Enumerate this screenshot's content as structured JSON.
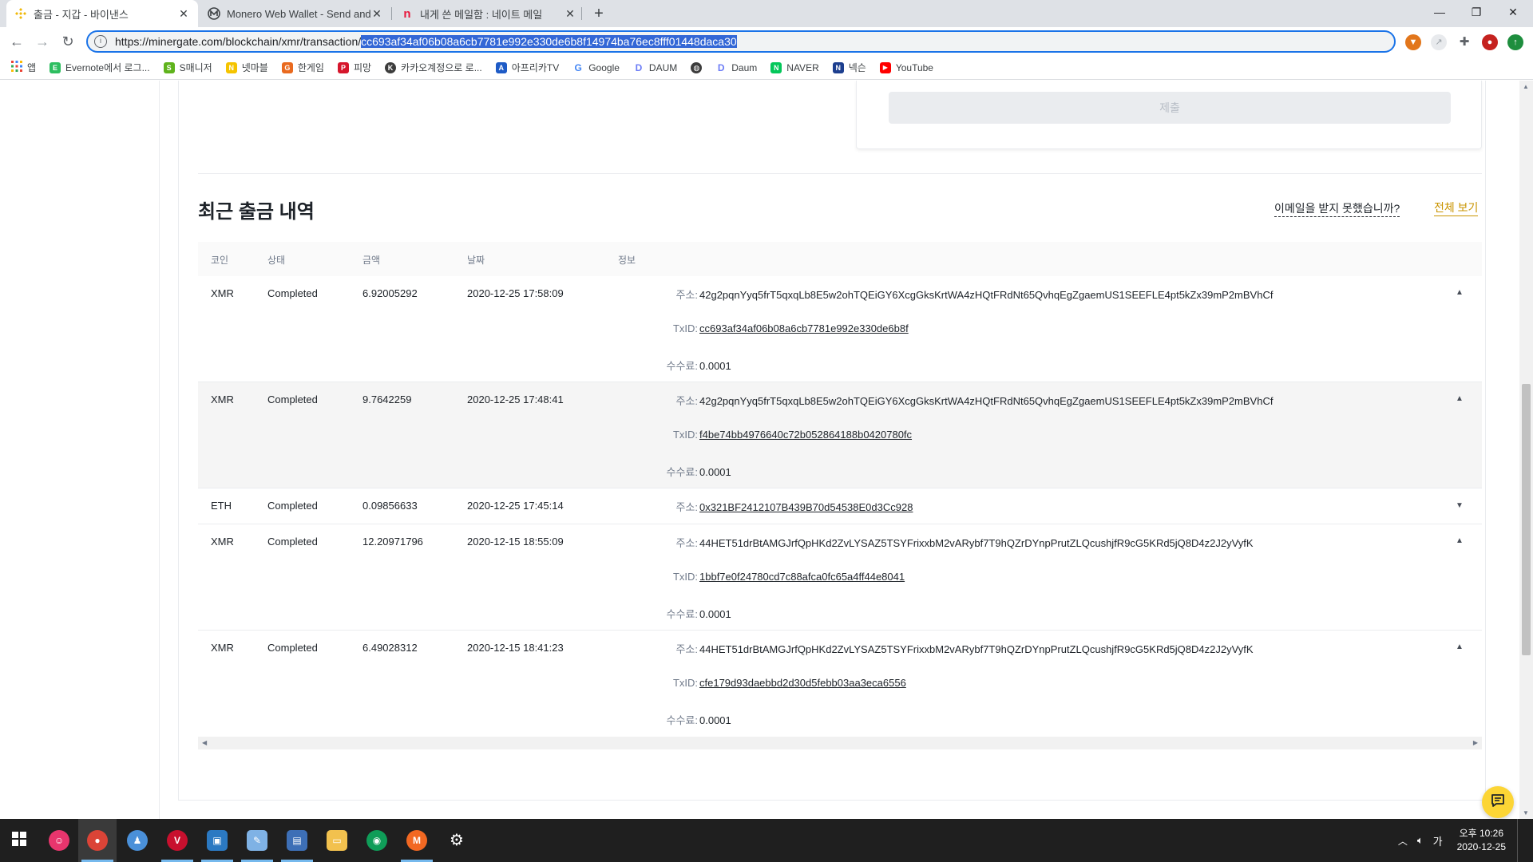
{
  "browser": {
    "tabs": [
      {
        "label": "출금 - 지갑 - 바이낸스",
        "active": true
      },
      {
        "label": "Monero Web Wallet - Send and",
        "active": false
      },
      {
        "label": "내게 쓴 메일함 : 네이트 메일",
        "active": false
      }
    ],
    "url_prefix": "https://minergate.com/blockchain/xmr/transaction/",
    "url_selected": "cc693af34af06b08a6cb7781e992e330de6b8f14974ba76ec8fff01448daca30",
    "bookmarks": [
      {
        "label": "앱",
        "icon": "apps-grid-icon",
        "color": "#ea4335"
      },
      {
        "label": "Evernote에서 로그...",
        "icon": "evernote-icon",
        "color": "#2dbe60"
      },
      {
        "label": "S매니저",
        "icon": "smanager-icon",
        "color": "#5fb31c"
      },
      {
        "label": "넷마블",
        "icon": "netmarble-icon",
        "color": "#f5c400"
      },
      {
        "label": "한게임",
        "icon": "hangame-icon",
        "color": "#e96a1f"
      },
      {
        "label": "피망",
        "icon": "pmang-icon",
        "color": "#d6162c"
      },
      {
        "label": "카카오계정으로 로...",
        "icon": "kakao-icon",
        "color": "#3c3c3c"
      },
      {
        "label": "아프리카TV",
        "icon": "afreecatv-icon",
        "color": "#1e5bc6"
      },
      {
        "label": "Google",
        "icon": "google-icon",
        "color": "#4285f4"
      },
      {
        "label": "DAUM",
        "icon": "daum-icon",
        "color": "#6b7cf6"
      },
      {
        "label": "",
        "icon": "globe-icon",
        "color": "#3c3c3c"
      },
      {
        "label": "Daum",
        "icon": "daum-icon",
        "color": "#6b7cf6"
      },
      {
        "label": "NAVER",
        "icon": "naver-icon",
        "color": "#03c75a"
      },
      {
        "label": "넥슨",
        "icon": "nexon-icon",
        "color": "#1d3f8f"
      },
      {
        "label": "YouTube",
        "icon": "youtube-icon",
        "color": "#ff0000"
      }
    ]
  },
  "page": {
    "submit_label": "제출",
    "section_title": "최근 출금 내역",
    "email_help": "이메일을 받지 못했습니까?",
    "view_all": "전체 보기",
    "columns": {
      "coin": "코인",
      "status": "상태",
      "amount": "금액",
      "date": "날짜",
      "info": "정보"
    },
    "labels": {
      "address": "주소:",
      "txid": "TxID:",
      "fee": "수수료:"
    },
    "rows": [
      {
        "coin": "XMR",
        "status": "Completed",
        "amount": "6.92005292",
        "date": "2020-12-25 17:58:09",
        "address": "42g2pqnYyq5frT5qxqLb8E5w2ohTQEiGY6XcgGksKrtWA4zHQtFRdNt65QvhqEgZgaemUS1SEEFLE4pt5kZx39mP2mBVhCf",
        "txid": "cc693af34af06b08a6cb7781e992e330de6b8f",
        "fee": "0.0001",
        "expanded": true
      },
      {
        "coin": "XMR",
        "status": "Completed",
        "amount": "9.7642259",
        "date": "2020-12-25 17:48:41",
        "address": "42g2pqnYyq5frT5qxqLb8E5w2ohTQEiGY6XcgGksKrtWA4zHQtFRdNt65QvhqEgZgaemUS1SEEFLE4pt5kZx39mP2mBVhCf",
        "txid": "f4be74bb4976640c72b052864188b0420780fc",
        "fee": "0.0001",
        "expanded": true
      },
      {
        "coin": "ETH",
        "status": "Completed",
        "amount": "0.09856633",
        "date": "2020-12-25 17:45:14",
        "address": "0x321BF2412107B439B70d54538E0d3Cc928",
        "expanded": false
      },
      {
        "coin": "XMR",
        "status": "Completed",
        "amount": "12.20971796",
        "date": "2020-12-15 18:55:09",
        "address": "44HET51drBtAMGJrfQpHKd2ZvLYSAZ5TSYFrixxbM2vARybf7T9hQZrDYnpPrutZLQcushjfR9cG5KRd5jQ8D4z2J2yVyfK",
        "txid": "1bbf7e0f24780cd7c88afca0fc65a4ff44e8041",
        "fee": "0.0001",
        "expanded": true
      },
      {
        "coin": "XMR",
        "status": "Completed",
        "amount": "6.49028312",
        "date": "2020-12-15 18:41:23",
        "address": "44HET51drBtAMGJrfQpHKd2ZvLYSAZ5TSYFrixxbM2vARybf7T9hQZrDYnpPrutZLQcushjfR9cG5KRd5jQ8D4z2J2yVyfK",
        "txid": "cfe179d93daebbd2d30d5febb03aa3eca6556",
        "fee": "0.0001",
        "expanded": true
      }
    ]
  },
  "taskbar": {
    "ime": "가",
    "ampm_time": "오후 10:26",
    "date": "2020-12-25"
  },
  "colors": {
    "accent_yellow": "#fcd535",
    "link_gold": "#c99400",
    "url_selection": "#3367d6"
  }
}
